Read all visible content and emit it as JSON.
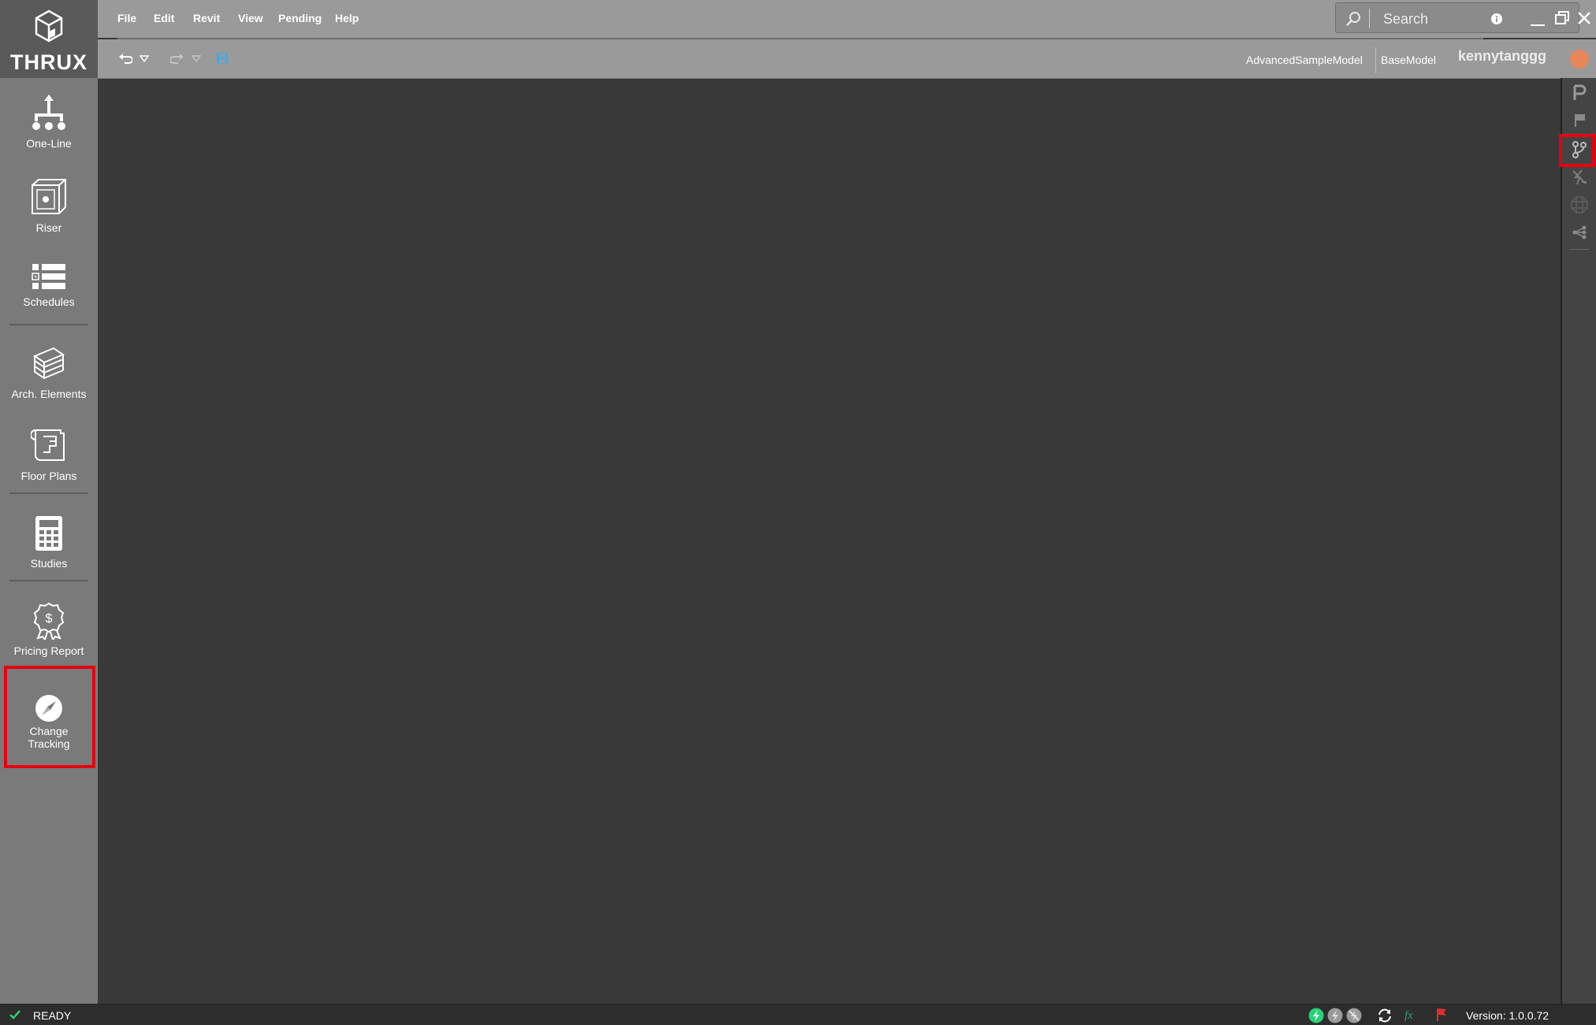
{
  "app": {
    "brand": "THRUX"
  },
  "menu": [
    "File",
    "Edit",
    "Revit",
    "View",
    "Pending",
    "Help"
  ],
  "search": {
    "placeholder": "Search"
  },
  "breadcrumbs": {
    "model": "AdvancedSampleModel",
    "base": "BaseModel"
  },
  "user": {
    "name": "kennytanggg"
  },
  "nav": {
    "one_line": "One-Line",
    "riser": "Riser",
    "schedules": "Schedules",
    "arch_elements": "Arch. Elements",
    "floor_plans": "Floor Plans",
    "studies": "Studies",
    "pricing_report": "Pricing Report",
    "change_tracking_line1": "Change",
    "change_tracking_line2": "Tracking"
  },
  "status": {
    "text": "READY",
    "version": "Version:  1.0.0.72"
  },
  "colors": {
    "accent_red": "#e60012",
    "green": "#2ecc71",
    "avatar": "#e8865a",
    "fx": "#2aa36b"
  }
}
